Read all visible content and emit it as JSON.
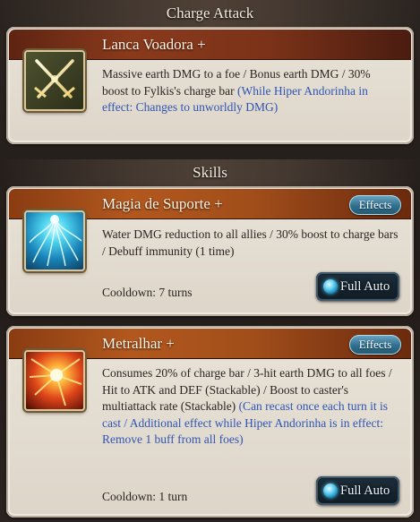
{
  "charge_attack": {
    "heading": "Charge Attack",
    "name": "Lanca Voadora",
    "plus": "+",
    "description": "Massive earth DMG to a foe / Bonus earth DMG / 30% boost to Fylkis's charge bar",
    "note": "(While Hiper Andorinha in effect: Changes to unworldly DMG)",
    "icon": "crossed-swords-icon"
  },
  "skills": {
    "heading": "Skills",
    "items": [
      {
        "name": "Magia de Suporte",
        "plus": "+",
        "effects_label": "Effects",
        "description": "Water DMG reduction to all allies / 30% boost to charge bars / Debuff immunity (1 time)",
        "cooldown": "Cooldown: 7 turns",
        "button": "Full Auto",
        "icon": "water-light-icon"
      },
      {
        "name": "Metralhar",
        "plus": "+",
        "effects_label": "Effects",
        "description": "Consumes 20% of charge bar / 3-hit earth DMG to all foes / Hit to ATK and DEF (Stackable) / Boost to caster's multiattack rate (Stackable)",
        "note": "(Can recast once each turn it is cast / Additional effect while Hiper Andorinha is in effect: Remove 1 buff from all foes)",
        "cooldown": "Cooldown: 1 turn",
        "button": "Full Auto",
        "icon": "fire-burst-icon"
      }
    ]
  }
}
